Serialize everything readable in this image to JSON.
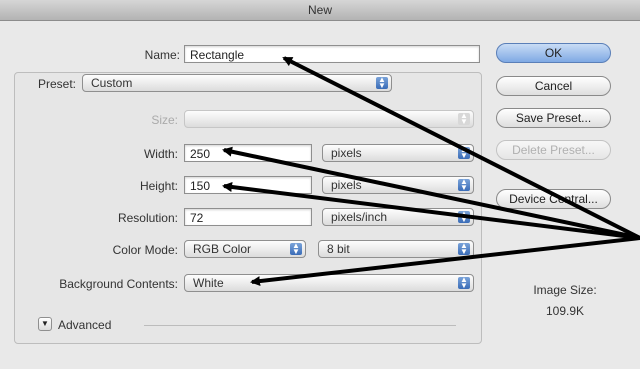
{
  "window": {
    "title": "New"
  },
  "form": {
    "name_label": "Name:",
    "name_value": "Rectangle",
    "preset_label": "Preset:",
    "preset_value": "Custom",
    "size_label": "Size:",
    "size_value": "",
    "width_label": "Width:",
    "width_value": "250",
    "width_unit": "pixels",
    "height_label": "Height:",
    "height_value": "150",
    "height_unit": "pixels",
    "resolution_label": "Resolution:",
    "resolution_value": "72",
    "resolution_unit": "pixels/inch",
    "color_mode_label": "Color Mode:",
    "color_mode_value": "RGB Color",
    "bit_depth_value": "8 bit",
    "background_label": "Background Contents:",
    "background_value": "White",
    "advanced_label": "Advanced"
  },
  "buttons": {
    "ok": "OK",
    "cancel": "Cancel",
    "save_preset": "Save Preset...",
    "delete_preset": "Delete Preset...",
    "device_central": "Device Central..."
  },
  "info": {
    "image_size_label": "Image Size:",
    "image_size_value": "109.9K"
  },
  "icons": {
    "popup_arrows": "updown-arrows-icon",
    "advanced_toggle": "disclosure-triangle-icon"
  },
  "colors": {
    "default_button": "#7fa9e4",
    "annotation_arrow": "#000000"
  }
}
